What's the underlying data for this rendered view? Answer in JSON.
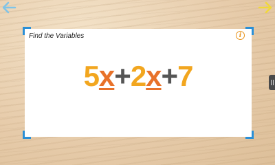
{
  "nav": {
    "back_icon": "arrow-left-icon",
    "forward_icon": "arrow-right-icon",
    "back_color": "#7fc4e8",
    "forward_color": "#f0d83a"
  },
  "card": {
    "title": "Find the Variables",
    "info_label": "i",
    "accent_color": "#2a8fd6"
  },
  "equation": {
    "terms": [
      {
        "coef": "5",
        "var": "x"
      },
      {
        "op": "+"
      },
      {
        "coef": "2",
        "var": "x"
      },
      {
        "op": "+"
      },
      {
        "coef": "7"
      }
    ]
  },
  "side_handle": {
    "icon": "drag-handle-icon"
  }
}
